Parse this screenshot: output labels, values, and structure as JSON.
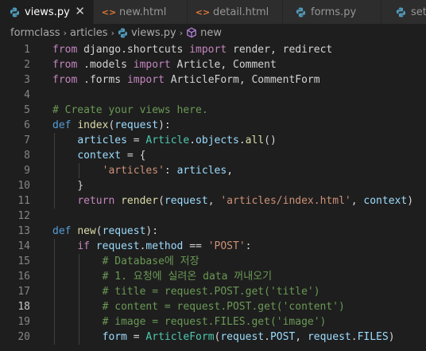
{
  "tabs": [
    {
      "name": "views.py",
      "icon": "python-file-icon",
      "active": true,
      "close": "✕"
    },
    {
      "name": "new.html",
      "icon": "html-file-icon",
      "active": false
    },
    {
      "name": "detail.html",
      "icon": "html-file-icon",
      "active": false
    },
    {
      "name": "forms.py",
      "icon": "python-file-icon",
      "active": false
    },
    {
      "name": "setti",
      "icon": "python-file-icon",
      "active": false
    }
  ],
  "breadcrumb": {
    "items": [
      "formclass",
      "articles",
      "views.py",
      "new"
    ],
    "separator": "›"
  },
  "editor": {
    "current_line": 18,
    "lines": [
      {
        "n": "1",
        "tokens": [
          [
            "kw",
            "from"
          ],
          [
            "tx",
            " django.shortcuts "
          ],
          [
            "kw",
            "import"
          ],
          [
            "tx",
            " render, redirect"
          ]
        ]
      },
      {
        "n": "2",
        "tokens": [
          [
            "kw",
            "from"
          ],
          [
            "tx",
            " .models "
          ],
          [
            "kw",
            "import"
          ],
          [
            "tx",
            " Article, Comment"
          ]
        ]
      },
      {
        "n": "3",
        "tokens": [
          [
            "kw",
            "from"
          ],
          [
            "tx",
            " .forms "
          ],
          [
            "kw",
            "import"
          ],
          [
            "tx",
            " ArticleForm, CommentForm"
          ]
        ]
      },
      {
        "n": "4",
        "tokens": []
      },
      {
        "n": "5",
        "tokens": [
          [
            "cm",
            "# Create your views here."
          ]
        ]
      },
      {
        "n": "6",
        "tokens": [
          [
            "df",
            "def"
          ],
          [
            "tx",
            " "
          ],
          [
            "fn",
            "index"
          ],
          [
            "tx",
            "("
          ],
          [
            "vr",
            "request"
          ],
          [
            "tx",
            "):"
          ]
        ]
      },
      {
        "n": "7",
        "tokens": [
          [
            "tx",
            "    "
          ],
          [
            "vr",
            "articles"
          ],
          [
            "tx",
            " = "
          ],
          [
            "cl",
            "Article"
          ],
          [
            "tx",
            "."
          ],
          [
            "vr",
            "objects"
          ],
          [
            "tx",
            "."
          ],
          [
            "fn",
            "all"
          ],
          [
            "tx",
            "()"
          ]
        ]
      },
      {
        "n": "8",
        "tokens": [
          [
            "tx",
            "    "
          ],
          [
            "vr",
            "context"
          ],
          [
            "tx",
            " = {"
          ]
        ]
      },
      {
        "n": "9",
        "tokens": [
          [
            "tx",
            "        "
          ],
          [
            "st",
            "'articles'"
          ],
          [
            "tx",
            ": "
          ],
          [
            "vr",
            "articles"
          ],
          [
            "tx",
            ","
          ]
        ]
      },
      {
        "n": "10",
        "tokens": [
          [
            "tx",
            "    }"
          ]
        ]
      },
      {
        "n": "11",
        "tokens": [
          [
            "tx",
            "    "
          ],
          [
            "kw",
            "return"
          ],
          [
            "tx",
            " "
          ],
          [
            "fn",
            "render"
          ],
          [
            "tx",
            "("
          ],
          [
            "vr",
            "request"
          ],
          [
            "tx",
            ", "
          ],
          [
            "st",
            "'articles/index.html'"
          ],
          [
            "tx",
            ", "
          ],
          [
            "vr",
            "context"
          ],
          [
            "tx",
            ")"
          ]
        ]
      },
      {
        "n": "12",
        "tokens": []
      },
      {
        "n": "13",
        "tokens": [
          [
            "df",
            "def"
          ],
          [
            "tx",
            " "
          ],
          [
            "fn",
            "new"
          ],
          [
            "tx",
            "("
          ],
          [
            "vr",
            "request"
          ],
          [
            "tx",
            "):"
          ]
        ]
      },
      {
        "n": "14",
        "tokens": [
          [
            "tx",
            "    "
          ],
          [
            "kw",
            "if"
          ],
          [
            "tx",
            " "
          ],
          [
            "vr",
            "request"
          ],
          [
            "tx",
            "."
          ],
          [
            "vr",
            "method"
          ],
          [
            "tx",
            " == "
          ],
          [
            "st",
            "'POST'"
          ],
          [
            "tx",
            ":"
          ]
        ]
      },
      {
        "n": "15",
        "tokens": [
          [
            "tx",
            "        "
          ],
          [
            "cm",
            "# Database에 저장"
          ]
        ]
      },
      {
        "n": "16",
        "tokens": [
          [
            "tx",
            "        "
          ],
          [
            "cm",
            "# 1. 요청에 실려온 data 꺼내오기"
          ]
        ]
      },
      {
        "n": "17",
        "tokens": [
          [
            "tx",
            "        "
          ],
          [
            "cm",
            "# title = request.POST.get('title')"
          ]
        ]
      },
      {
        "n": "18",
        "tokens": [
          [
            "tx",
            "        "
          ],
          [
            "cm",
            "# content = request.POST.get('content')"
          ]
        ]
      },
      {
        "n": "19",
        "tokens": [
          [
            "tx",
            "        "
          ],
          [
            "cm",
            "# image = request.FILES.get('image')"
          ]
        ]
      },
      {
        "n": "20",
        "tokens": [
          [
            "tx",
            "        "
          ],
          [
            "vr",
            "form"
          ],
          [
            "tx",
            " = "
          ],
          [
            "cl",
            "ArticleForm"
          ],
          [
            "tx",
            "("
          ],
          [
            "vr",
            "request"
          ],
          [
            "tx",
            "."
          ],
          [
            "vr",
            "POST"
          ],
          [
            "tx",
            ", "
          ],
          [
            "vr",
            "request"
          ],
          [
            "tx",
            "."
          ],
          [
            "vr",
            "FILES"
          ],
          [
            "tx",
            ")"
          ]
        ]
      }
    ]
  },
  "colors": {
    "background": "#1e1e1e",
    "tabbar": "#252526",
    "keyword": "#c586c0",
    "def": "#569cd6",
    "function": "#dcdcaa",
    "variable": "#9cdcfe",
    "class": "#4ec9b0",
    "string": "#ce9178",
    "comment": "#6a9955"
  }
}
